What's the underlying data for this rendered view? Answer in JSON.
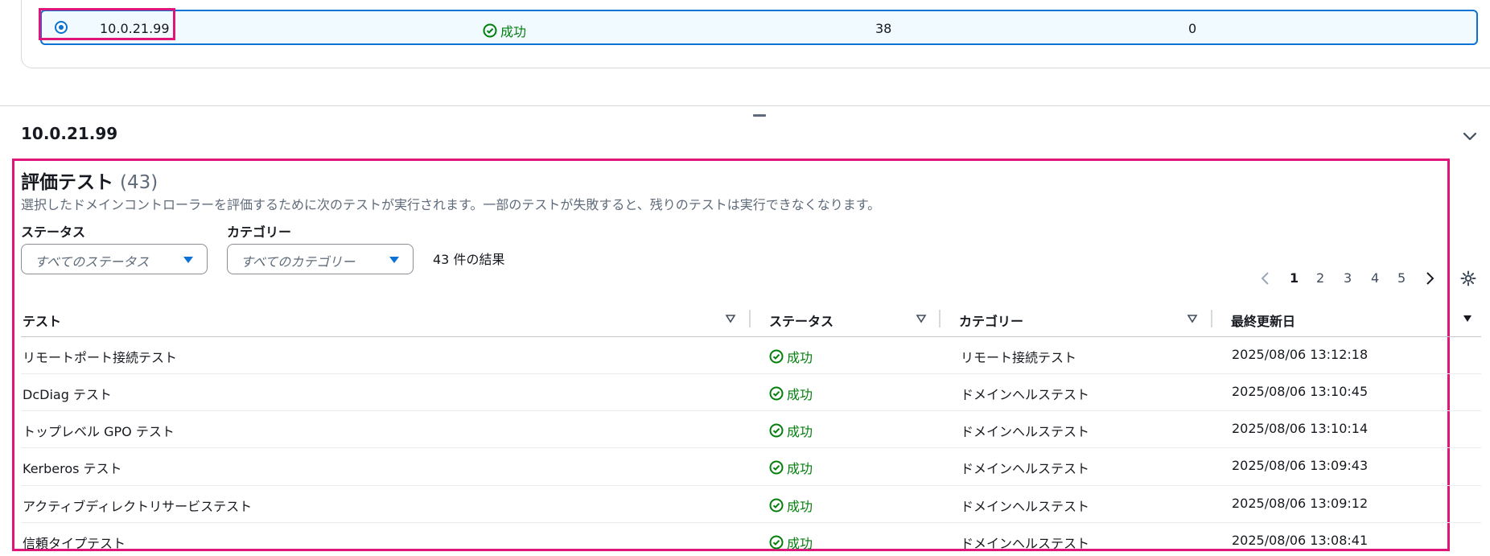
{
  "top_row": {
    "ip": "10.0.21.99",
    "status": "成功",
    "count": "38",
    "failed": "0"
  },
  "section": {
    "title": "10.0.21.99"
  },
  "tests": {
    "heading": "評価テスト",
    "count": "(43)",
    "description": "選択したドメインコントローラーを評価するために次のテストが実行されます。一部のテストが失敗すると、残りのテストは実行できなくなります。",
    "filters": {
      "status_label": "ステータス",
      "status_placeholder": "すべてのステータス",
      "category_label": "カテゴリー",
      "category_placeholder": "すべてのカテゴリー"
    },
    "results": "43 件の結果",
    "pagination": {
      "pages": [
        "1",
        "2",
        "3",
        "4",
        "5"
      ],
      "current": "1"
    },
    "columns": [
      "テスト",
      "ステータス",
      "カテゴリー",
      "最終更新日"
    ],
    "rows": [
      {
        "test": "リモートポート接続テスト",
        "status": "成功",
        "category": "リモート接続テスト",
        "updated": "2025/08/06 13:12:18"
      },
      {
        "test": "DcDiag テスト",
        "status": "成功",
        "category": "ドメインヘルステスト",
        "updated": "2025/08/06 13:10:45"
      },
      {
        "test": "トップレベル GPO テスト",
        "status": "成功",
        "category": "ドメインヘルステスト",
        "updated": "2025/08/06 13:10:14"
      },
      {
        "test": "Kerberos テスト",
        "status": "成功",
        "category": "ドメインヘルステスト",
        "updated": "2025/08/06 13:09:43"
      },
      {
        "test": "アクティブディレクトリサービステスト",
        "status": "成功",
        "category": "ドメインヘルステスト",
        "updated": "2025/08/06 13:09:12"
      },
      {
        "test": "信頼タイプテスト",
        "status": "成功",
        "category": "ドメインヘルステスト",
        "updated": "2025/08/06 13:08:41"
      }
    ]
  },
  "colors": {
    "accent": "#0972d3",
    "success": "#037f0c",
    "highlight": "#e0157a"
  }
}
